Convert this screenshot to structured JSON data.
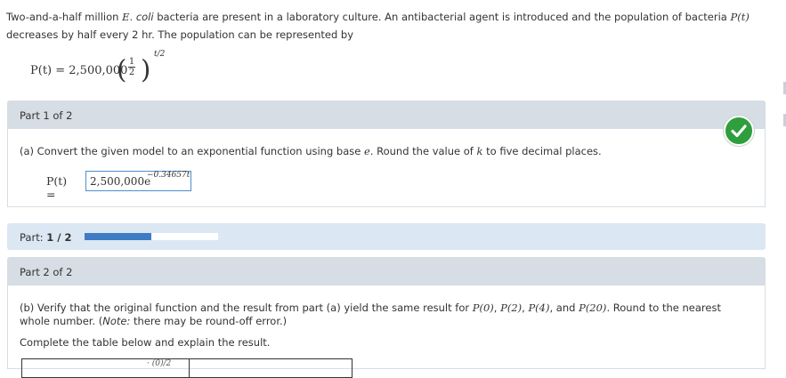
{
  "problem": {
    "intro_part1": "Two-and-a-half million ",
    "organism_E": "E.",
    "organism_coli": " coli",
    "intro_part2": " bacteria are present in a laboratory culture. An antibacterial agent is introduced and the population of bacteria ",
    "Pt": "P(t)",
    "intro_part3": " decreases by half every 2 hr. The population can be represented by",
    "formula_lhs": "P(t) = 2,500,000",
    "frac_num": "1",
    "frac_den": "2",
    "formula_exp": "t/2"
  },
  "part1": {
    "header": "Part 1 of 2",
    "question_pre": "(a) Convert the given model to an exponential function using base ",
    "base": "e",
    "question_mid": ". Round the value of ",
    "k": "k",
    "question_post": " to five decimal places.",
    "answer_lhs": "P(t) =",
    "answer_base": "2,500,000e",
    "answer_exp": "−0.34657t",
    "status_icon": "check-icon"
  },
  "progress": {
    "label": "Part:",
    "value": "1 / 2",
    "fraction": 0.5,
    "fill_color": "#3f7cc3"
  },
  "part2": {
    "header": "Part 2 of 2",
    "question_pre": "(b) Verify that the original function and the result from part (a) yield the same result for ",
    "p0": "P(0)",
    "p2": "P(2)",
    "p4": "P(4)",
    "and": "and",
    "p20": "P(20)",
    "question_post": ". Round to the nearest whole number. (",
    "note_label": "Note:",
    "note_text": " there may be round-off error.)",
    "complete": "Complete the table below and explain the result.",
    "table_fragment": "· (0)/2"
  },
  "colors": {
    "header_bg": "#d6dde4",
    "progress_bg": "#dbe7f2",
    "check_green": "#2e9e3e",
    "input_border": "#4a8fce"
  }
}
